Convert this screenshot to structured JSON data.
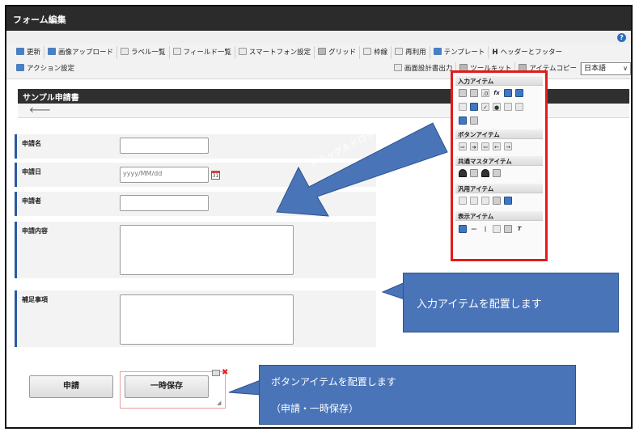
{
  "window": {
    "title": "フォーム編集"
  },
  "toolbar": {
    "row1": [
      {
        "label": "更新",
        "icon": "refresh-icon"
      },
      {
        "label": "画像アップロード",
        "icon": "image-upload-icon"
      },
      {
        "label": "ラベル一覧",
        "icon": "label-list-icon"
      },
      {
        "label": "フィールド一覧",
        "icon": "field-list-icon"
      },
      {
        "label": "スマートフォン設定",
        "icon": "smartphone-icon"
      },
      {
        "label": "グリッド",
        "icon": "grid-icon"
      },
      {
        "label": "枠線",
        "icon": "border-icon"
      },
      {
        "label": "再利用",
        "icon": "reuse-icon"
      },
      {
        "label": "テンプレート",
        "icon": "template-icon"
      },
      {
        "label": "ヘッダーとフッター",
        "icon": "header-footer-icon"
      }
    ],
    "row2_left": [
      {
        "label": "アクション設定",
        "icon": "action-settings-icon"
      }
    ],
    "row2_right": [
      {
        "label": "画面設計書出力",
        "icon": "design-doc-export-icon"
      },
      {
        "label": "ツールキット",
        "icon": "toolkit-icon"
      },
      {
        "label": "アイテムコピー",
        "icon": "item-copy-icon"
      }
    ],
    "language": {
      "selected": "日本語"
    }
  },
  "form": {
    "title": "サンプル申請書",
    "fields": [
      {
        "label": "申請名",
        "value": "",
        "placeholder": ""
      },
      {
        "label": "申請日",
        "value": "",
        "placeholder": "yyyy/MM/dd"
      },
      {
        "label": "申請者",
        "value": "",
        "placeholder": ""
      },
      {
        "label": "申請内容",
        "value": ""
      },
      {
        "label": "補足事項",
        "value": ""
      }
    ],
    "calendar_icon_text": "31",
    "buttons": {
      "apply": "申請",
      "temp_save": "一時保存"
    }
  },
  "palette": {
    "sections": [
      {
        "title": "入力アイテム"
      },
      {
        "title": "ボタンアイテム"
      },
      {
        "title": "共通マスタアイテム"
      },
      {
        "title": "汎用アイテム"
      },
      {
        "title": "表示アイテム"
      }
    ]
  },
  "callouts": {
    "drag": "ドラッグ＆ドロップ",
    "input": "入力アイテムを配置します",
    "button_line1": "ボタンアイテムを配置します",
    "button_line2": "（申請・一時保存）"
  },
  "colors": {
    "titlebar": "#2b2b2b",
    "callout": "#4a74b8",
    "highlight": "#e21b1b",
    "label_accent": "#2a5aa0"
  }
}
